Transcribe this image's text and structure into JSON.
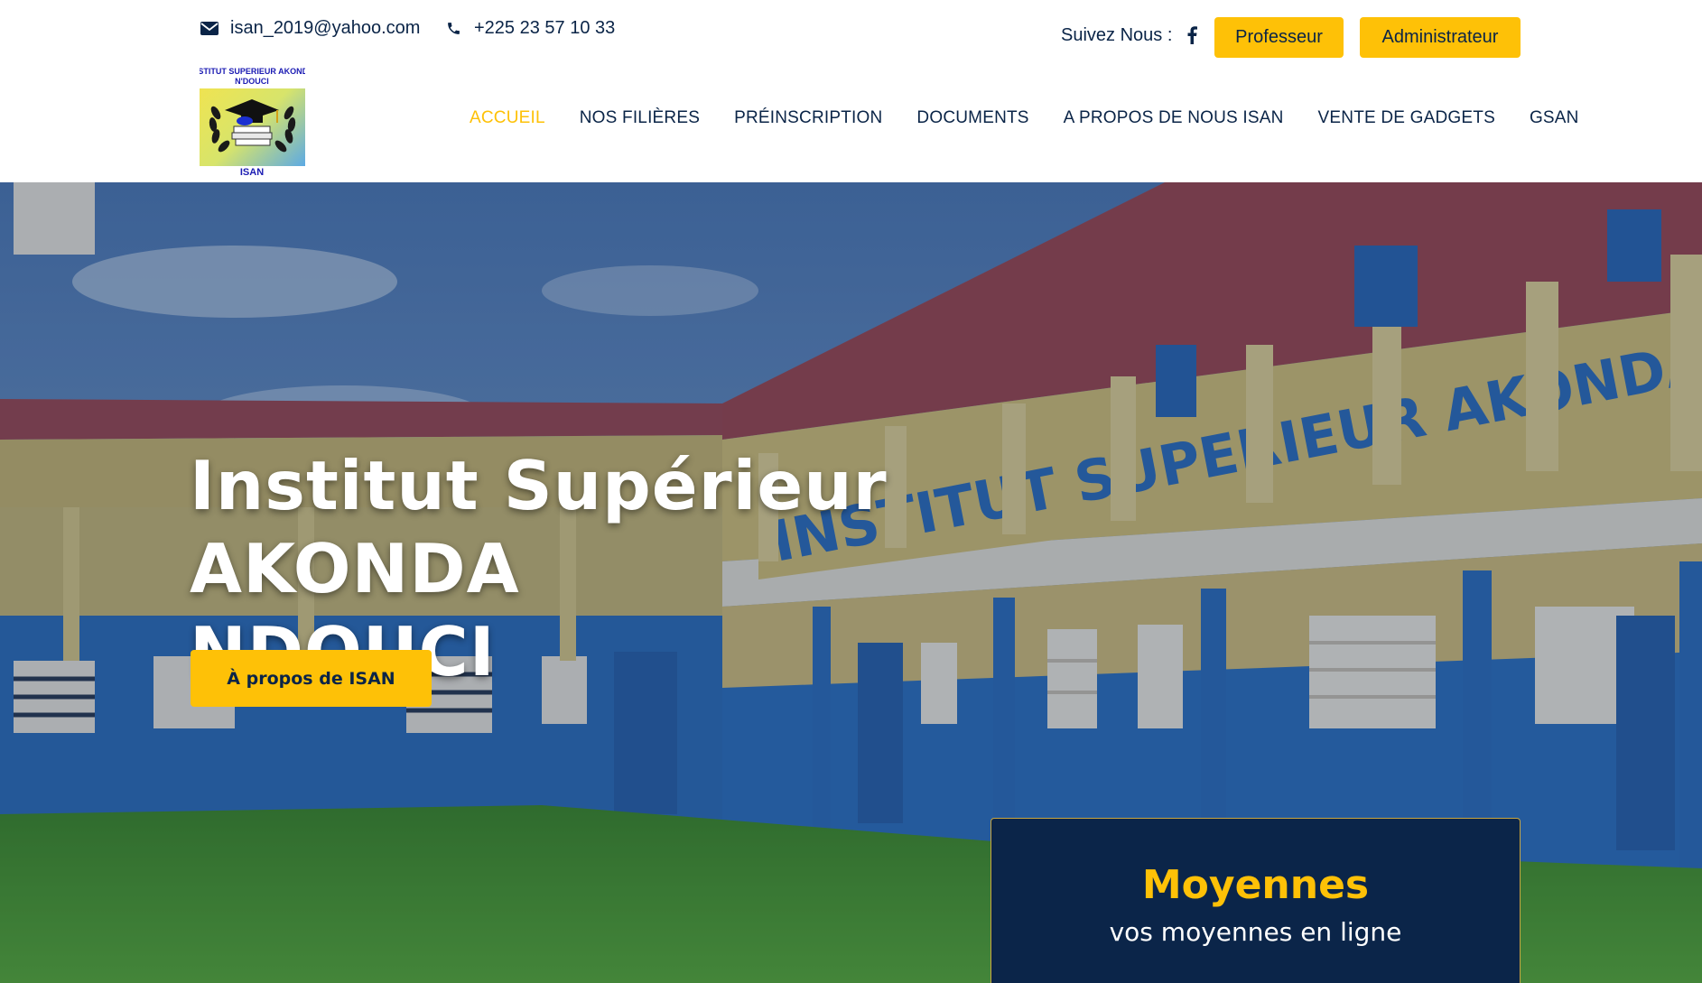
{
  "topbar": {
    "email": "isan_2019@yahoo.com",
    "phone": "+225 23 57 10 33",
    "follow_label": "Suivez Nous :",
    "facebook_icon": "facebook-icon",
    "buttons": {
      "professeur": "Professeur",
      "administrateur": "Administrateur"
    }
  },
  "logo": {
    "line1": "INSTITUT SUPERIEUR AKONDA",
    "line2": "N'DOUCI",
    "bottom": "ISAN"
  },
  "nav": {
    "items": [
      {
        "label": "ACCUEIL",
        "active": true
      },
      {
        "label": "NOS FILIÈRES",
        "active": false
      },
      {
        "label": "PRÉINSCRIPTION",
        "active": false
      },
      {
        "label": "DOCUMENTS",
        "active": false
      },
      {
        "label": "A PROPOS DE NOUS ISAN",
        "active": false
      },
      {
        "label": "VENTE DE GADGETS",
        "active": false
      },
      {
        "label": "GSAN",
        "active": false
      }
    ]
  },
  "hero": {
    "title_line1": "Institut Supérieur AKONDA",
    "title_line2": "NDOUCI",
    "button_label": "À propos de ISAN",
    "building_sign": "INSTITUT SUPERIEUR AKONDA NDOUCI"
  },
  "card": {
    "title": "Moyennes",
    "subtitle": "vos moyennes en ligne"
  },
  "colors": {
    "accent": "#fec107",
    "navy": "#0a2447",
    "card_bg": "#0b2549"
  }
}
